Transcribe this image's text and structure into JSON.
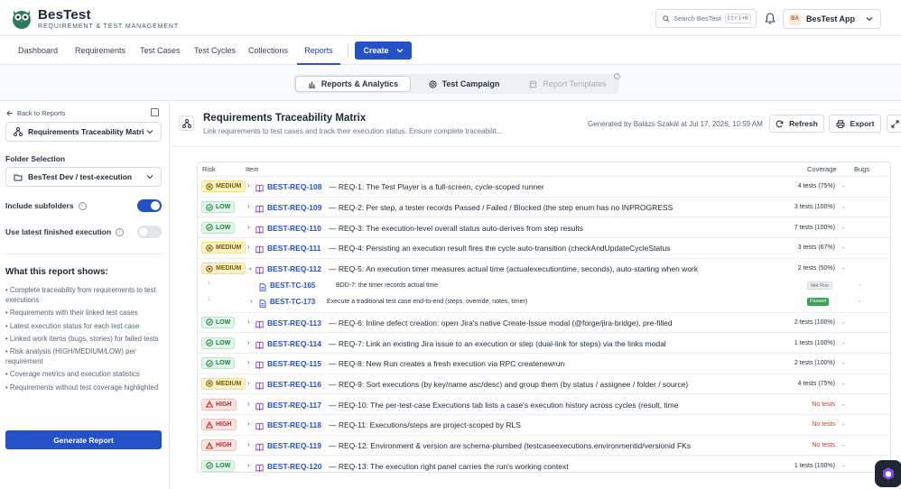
{
  "app": {
    "name": "BesTest",
    "tagline": "REQUIREMENT & TEST MANAGEMENT"
  },
  "search": {
    "placeholder": "Search BesTest",
    "shortcut": "Ctrl+K"
  },
  "workspace": {
    "initials": "BA",
    "name": "BesTest App"
  },
  "nav": {
    "tabs": [
      "Dashboard",
      "Requirements",
      "Test Cases",
      "Test Cycles",
      "Collections",
      "Reports"
    ],
    "active": "Reports",
    "create_label": "Create"
  },
  "subnav": {
    "items": [
      "Reports & Analytics",
      "Test Campaign",
      "Report Templates"
    ]
  },
  "sidebar": {
    "back_label": "Back to Reports",
    "report_select": "Requirements Traceability Matri",
    "folder_label": "Folder Selection",
    "folder_value": "BesTest Dev / test-execution",
    "include_subfolders": {
      "label": "Include subfolders",
      "on": true
    },
    "latest_execution": {
      "label": "Use latest finished execution",
      "on": false
    },
    "what_title": "What this report shows:",
    "bullets": [
      "Complete traceability from requirements to test executions",
      "Requirements with their linked test cases",
      "Latest execution status for each test case",
      "Linked work items (bugs, stories) for failed tests",
      "Risk analysis (HIGH/MEDIUM/LOW) per requirement",
      "Coverage metrics and execution statistics",
      "Requirements without test coverage highlighted"
    ],
    "generate_label": "Generate Report"
  },
  "report": {
    "title": "Requirements Traceability Matrix",
    "subtitle": "Link requirements to test cases and track their execution status. Ensure complete traceabilit...",
    "generated": "Generated by Balázs Szakál at Jul 17, 2026, 10:59 AM",
    "refresh_label": "Refresh",
    "export_label": "Export"
  },
  "table": {
    "headers": {
      "risk": "Risk",
      "item": "Item",
      "coverage": "Coverage",
      "bugs": "Bugs"
    },
    "rows": [
      {
        "risk": "MEDIUM",
        "id": "BEST-REQ-108",
        "text": "— REQ-1: The Test Player is a full-screen, cycle-scoped runner",
        "coverage": "4 tests (75%)",
        "bugs": "-"
      },
      {
        "risk": "LOW",
        "id": "BEST-REQ-109",
        "text": "— REQ-2: Per step, a tester records Passed / Failed / Blocked (the step enum has no INPROGRESS",
        "coverage": "3 tests (100%)",
        "bugs": "-"
      },
      {
        "risk": "LOW",
        "id": "BEST-REQ-110",
        "text": "— REQ-3: The execution-level overall status auto-derives from step results",
        "coverage": "7 tests (100%)",
        "bugs": "-"
      },
      {
        "risk": "MEDIUM",
        "id": "BEST-REQ-111",
        "text": "— REQ-4: Persisting an execution result fires the cycle auto-transition (checkAndUpdateCycleStatus",
        "coverage": "3 tests (67%)",
        "bugs": "-"
      },
      {
        "risk": "MEDIUM",
        "id": "BEST-REQ-112",
        "text": "— REQ-5: An execution timer measures actual time (actualexecutiontime, seconds), auto-starting when work",
        "coverage": "2 tests (50%)",
        "bugs": "-",
        "expanded": true,
        "children": [
          {
            "id": "BEST-TC-165",
            "text": "BDD-7: the timer records actual time",
            "status": "Not Run",
            "bugs": "-"
          },
          {
            "id": "BEST-TC-173",
            "text": "Execute a traditional test case end-to-end (steps, override, notes, timer)",
            "status": "Passed",
            "bugs": "-"
          }
        ]
      },
      {
        "risk": "LOW",
        "id": "BEST-REQ-113",
        "text": "— REQ-6: Inline defect creation: open Jira's native Create-Issue modal (@forge/jira-bridge), pre-filled",
        "coverage": "2 tests (100%)",
        "bugs": "-"
      },
      {
        "risk": "LOW",
        "id": "BEST-REQ-114",
        "text": "— REQ-7: Link an existing Jira issue to an execution or step (dual-link for steps) via the links modal",
        "coverage": "1 tests (100%)",
        "bugs": "-"
      },
      {
        "risk": "LOW",
        "id": "BEST-REQ-115",
        "text": "— REQ-8: New Run creates a fresh execution via RPC createnewrun",
        "coverage": "2 tests (100%)",
        "bugs": "-"
      },
      {
        "risk": "MEDIUM",
        "id": "BEST-REQ-116",
        "text": "— REQ-9: Sort executions (by key/name asc/desc) and group them (by status / assignee / folder / source)",
        "coverage": "4 tests (75%)",
        "bugs": "-"
      },
      {
        "risk": "HIGH",
        "id": "BEST-REQ-117",
        "text": "— REQ-10: The per-test-case Executions tab lists a case's execution history across cycles (result, time",
        "coverage": "No tests",
        "bugs": "-"
      },
      {
        "risk": "HIGH",
        "id": "BEST-REQ-118",
        "text": "— REQ-11: Executions/steps are project-scoped by RLS",
        "coverage": "No tests",
        "bugs": "-"
      },
      {
        "risk": "HIGH",
        "id": "BEST-REQ-119",
        "text": "— REQ-12: Environment & version are schema-plumbed (testcaseexecutions.environmentid/versionid FKs",
        "coverage": "No tests",
        "bugs": "-"
      },
      {
        "risk": "LOW",
        "id": "BEST-REQ-120",
        "text": "— REQ-13: The execution right panel carries the run's working context",
        "coverage": "1 tests (100%)",
        "bugs": "-"
      }
    ]
  },
  "colors": {
    "primary": "#2451c6",
    "medium": "#fdf3c6",
    "low": "#e1f6e8",
    "high": "#fde4e2",
    "no_tests": "#d0402f",
    "passed": "#3aa35a"
  }
}
